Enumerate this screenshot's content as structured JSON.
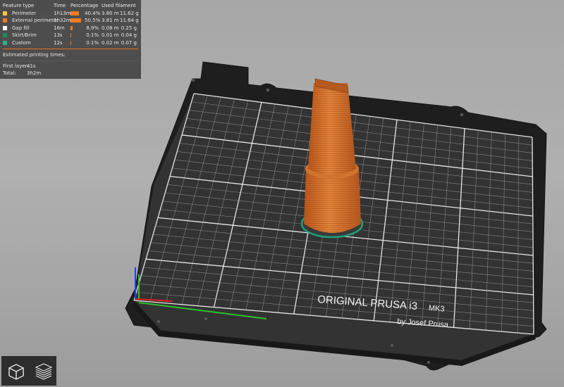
{
  "legend": {
    "headers": [
      "Feature type",
      "Time",
      "Percentage",
      "Used filament"
    ],
    "rows": [
      {
        "feature": "Perimeter",
        "time": "1h13m",
        "percent": "40.4%",
        "length": "3.80 m",
        "weight": "11.62 g",
        "color": "#f5c542",
        "fraction": 0.404
      },
      {
        "feature": "External perimeter",
        "time": "1h32m",
        "percent": "50.5%",
        "length": "3.81 m",
        "weight": "11.64 g",
        "color": "#f07b22",
        "fraction": 0.505
      },
      {
        "feature": "Gap fill",
        "time": "16m",
        "percent": "8.9%",
        "length": "0.08 m",
        "weight": "0.25 g",
        "color": "#ffffff",
        "fraction": 0.089
      },
      {
        "feature": "Skirt/Brim",
        "time": "13s",
        "percent": "0.1%",
        "length": "0.01 m",
        "weight": "0.04 g",
        "color": "#1f8a5e",
        "fraction": 0.001
      },
      {
        "feature": "Custom",
        "time": "12s",
        "percent": "0.1%",
        "length": "0.02 m",
        "weight": "0.07 g",
        "color": "#2bb28a",
        "fraction": 0.001
      }
    ],
    "estimated_title": "Estimated printing times:",
    "first_layer_label": "First layer:",
    "first_layer_value": "41s",
    "total_label": "Total:",
    "total_value": "3h2m"
  },
  "bed": {
    "brand_line1": "ORIGINAL PRUSA i3",
    "brand_model": "MK3",
    "brand_line2": "by Josef Prusa"
  },
  "colors": {
    "model": "#d4762a",
    "bar": "#f07b22",
    "separator": "#e07020"
  },
  "view_buttons": [
    "iso-view",
    "layers-view"
  ]
}
